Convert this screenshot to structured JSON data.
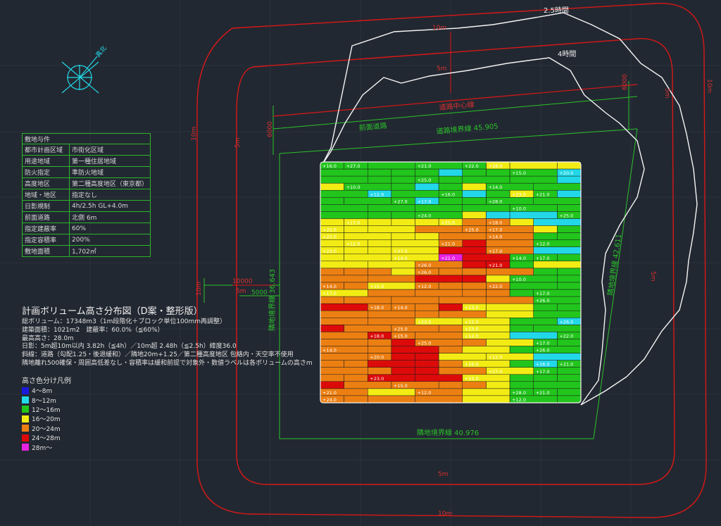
{
  "site_table": {
    "header": "敷地与件",
    "rows": [
      {
        "label": "都市計画区域",
        "value": "市街化区域"
      },
      {
        "label": "用途地域",
        "value": "第一種住居地域"
      },
      {
        "label": "防火指定",
        "value": "準防火地域"
      },
      {
        "label": "高度地区",
        "value": "第二種高度地区（東京都）"
      },
      {
        "label": "地域・地区",
        "value": "指定なし"
      },
      {
        "label": "日影規制",
        "value": "4h/2.5h GL+4.0m"
      },
      {
        "label": "前面道路",
        "value": "北側 6m"
      },
      {
        "label": "指定建蔽率",
        "value": "60%"
      },
      {
        "label": "指定容積率",
        "value": "200%"
      },
      {
        "label": "敷地面積",
        "value": "1,702㎡"
      }
    ]
  },
  "notes": {
    "title": "計画ボリューム高さ分布図（D案・整形版）",
    "lines": [
      "総ボリューム：17348m3（1m段階化＋ブロック単位100mm再調整）",
      "建築面積：1021m2　建蔽率：60.0%（≦60%）",
      "最高高さ：28.0m",
      "日影：5m超10m以内 3.82h（≦4h）／10m超 2.48h（≦2.5h）緯度36.0",
      "斜線：道路（勾配1.25・後退緩和）／隣地20m+1.25／第二種高度地区 包絡内・天空率不使用",
      "隣地離れ500確保・周囲高低差なし・容積率は緩和前提で対象外・数値ラベルは各ボリュームの高さm"
    ]
  },
  "legend": {
    "title": "高さ色分け凡例",
    "items": [
      {
        "label": "4～8m",
        "color": "#1a1adc"
      },
      {
        "label": "8～12m",
        "color": "#22d8e8"
      },
      {
        "label": "12～16m",
        "color": "#22c51c"
      },
      {
        "label": "16～20m",
        "color": "#f2ec14"
      },
      {
        "label": "20～24m",
        "color": "#ec7f12"
      },
      {
        "label": "24～28m",
        "color": "#dd0a0a"
      },
      {
        "label": "28m～",
        "color": "#e820e0"
      }
    ]
  },
  "drawing_labels": {
    "north": "真北",
    "shadow_2_5h": "2.5時間",
    "shadow_4h": "4時間",
    "road_centerline": "道路中心線",
    "front_road": "前面道路",
    "road_boundary": "道路境界線 45.905",
    "neighbor_boundary_left": "隣地境界線 36.643",
    "neighbor_boundary_right": "隣地境界線 42.611",
    "neighbor_boundary_bottom": "隣地境界線 40.976",
    "dim_10m": "10m",
    "dim_5m": "5m",
    "dim_6000": "6000",
    "dim_5000": "5000",
    "dim_10000": "10000"
  },
  "height_labels": [
    "+12.0",
    "+13.0",
    "+14.0",
    "+15.0",
    "+16.0",
    "+17.0",
    "+18.0",
    "+20.0",
    "+21.0",
    "+22.0",
    "+23.0",
    "+24.0",
    "+25.0",
    "+26.0",
    "+27.0",
    "+28.0",
    "+10.0"
  ]
}
